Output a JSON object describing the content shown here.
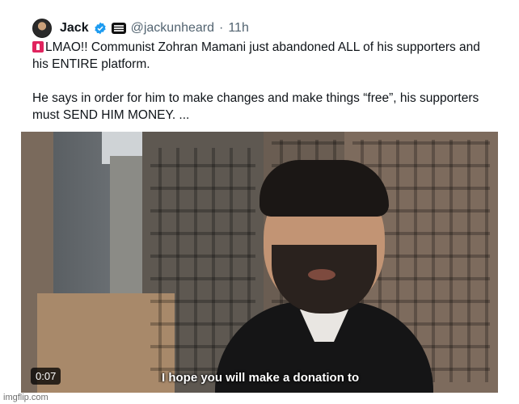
{
  "tweet": {
    "author_name": "Jack",
    "handle": "@jackunheard",
    "separator": "·",
    "time": "11h",
    "text_line1": "LMAO!! Communist Zohran Mamani just abandoned ALL of his supporters and his ENTIRE platform.",
    "text_line2": "He says in order for him to make changes and make things “free”, his supporters must SEND HIM MONEY. ...",
    "verified_color": "#1d9bf0",
    "siren_icon": "police-siren-icon"
  },
  "video": {
    "timestamp": "0:07",
    "caption": "I hope you will make a donation to"
  },
  "watermark": "imgflip.com"
}
